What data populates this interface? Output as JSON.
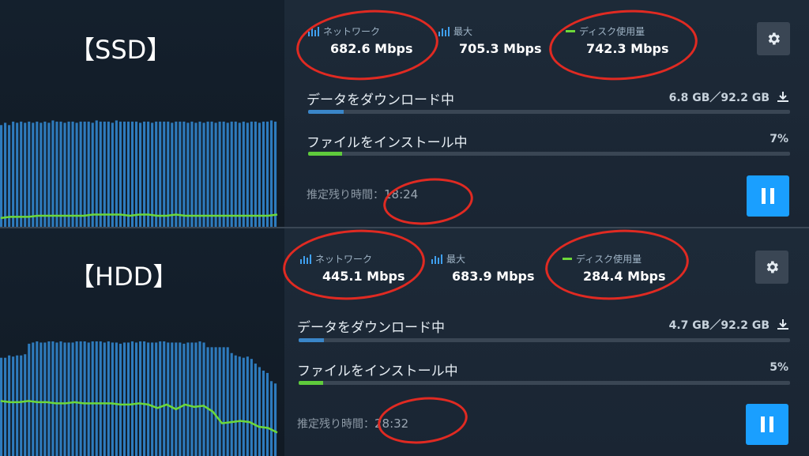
{
  "panels": [
    {
      "id": "ssd",
      "label": "【SSD】",
      "network_label": "ネットワーク",
      "network_value": "682.6 Mbps",
      "peak_label": "最大",
      "peak_value": "705.3 Mbps",
      "disk_label": "ディスク使用量",
      "disk_value": "742.3 Mbps",
      "download_label": "データをダウンロード中",
      "download_amount": "6.8 GB／92.2 GB",
      "download_progress": 0.074,
      "install_label": "ファイルをインストール中",
      "install_percent": "7%",
      "install_progress": 0.07,
      "time_label": "推定残り時間：",
      "time_value": "18:24",
      "bars": [
        0.93,
        0.95,
        0.93,
        0.96,
        0.95,
        0.96,
        0.95,
        0.96,
        0.95,
        0.96,
        0.95,
        0.96,
        0.95,
        0.97,
        0.96,
        0.96,
        0.95,
        0.96,
        0.96,
        0.95,
        0.96,
        0.96,
        0.96,
        0.95,
        0.97,
        0.96,
        0.96,
        0.96,
        0.95,
        0.97,
        0.96,
        0.96,
        0.96,
        0.96,
        0.96,
        0.95,
        0.96,
        0.96,
        0.95,
        0.96,
        0.96,
        0.96,
        0.96,
        0.95,
        0.96,
        0.96,
        0.96,
        0.95,
        0.96,
        0.95,
        0.96,
        0.95,
        0.96,
        0.96,
        0.95,
        0.96,
        0.96,
        0.95,
        0.96,
        0.96,
        0.95,
        0.96,
        0.95,
        0.96,
        0.96,
        0.95,
        0.96,
        0.96,
        0.97,
        0.96
      ],
      "disk_line": [
        0.13,
        0.14,
        0.14,
        0.14,
        0.15,
        0.15,
        0.15,
        0.15,
        0.15,
        0.15,
        0.16,
        0.16,
        0.16,
        0.16,
        0.15,
        0.16,
        0.16,
        0.15,
        0.15,
        0.16,
        0.15,
        0.15,
        0.15,
        0.15,
        0.15,
        0.15,
        0.15,
        0.15,
        0.15,
        0.15,
        0.16
      ]
    },
    {
      "id": "hdd",
      "label": "【HDD】",
      "network_label": "ネットワーク",
      "network_value": "445.1 Mbps",
      "peak_label": "最大",
      "peak_value": "683.9 Mbps",
      "disk_label": "ディスク使用量",
      "disk_value": "284.4 Mbps",
      "download_label": "データをダウンロード中",
      "download_amount": "4.7 GB／92.2 GB",
      "download_progress": 0.051,
      "install_label": "ファイルをインストール中",
      "install_percent": "5%",
      "install_progress": 0.05,
      "time_label": "推定残り時間：",
      "time_value": "28:32",
      "bars": [
        0.84,
        0.84,
        0.86,
        0.85,
        0.86,
        0.86,
        0.87,
        0.96,
        0.97,
        0.98,
        0.97,
        0.97,
        0.98,
        0.98,
        0.97,
        0.98,
        0.97,
        0.97,
        0.97,
        0.98,
        0.98,
        0.98,
        0.97,
        0.98,
        0.98,
        0.98,
        0.97,
        0.98,
        0.97,
        0.97,
        0.96,
        0.97,
        0.97,
        0.98,
        0.97,
        0.98,
        0.98,
        0.97,
        0.97,
        0.97,
        0.98,
        0.98,
        0.97,
        0.97,
        0.97,
        0.97,
        0.96,
        0.97,
        0.97,
        0.97,
        0.98,
        0.97,
        0.93,
        0.93,
        0.93,
        0.93,
        0.93,
        0.93,
        0.88,
        0.86,
        0.85,
        0.84,
        0.85,
        0.83,
        0.79,
        0.76,
        0.73,
        0.71,
        0.64,
        0.62
      ],
      "disk_line": [
        0.47,
        0.46,
        0.46,
        0.47,
        0.46,
        0.46,
        0.45,
        0.45,
        0.46,
        0.45,
        0.45,
        0.45,
        0.45,
        0.44,
        0.44,
        0.45,
        0.44,
        0.41,
        0.44,
        0.4,
        0.44,
        0.42,
        0.43,
        0.38,
        0.28,
        0.29,
        0.3,
        0.29,
        0.25,
        0.24,
        0.2
      ]
    }
  ],
  "colors": {
    "accent": "#1a9fff",
    "bar": "#2e7bbd",
    "bar_edge": "#4a9be0",
    "disk": "#6dd83a",
    "download_fill": "#3a86c8",
    "install_fill": "#5fcb3c",
    "annotation": "#e02a22"
  },
  "icons": {
    "network": "bar-chart-icon",
    "peak": "bar-chart-icon",
    "disk": "line-icon",
    "settings": "gear-icon",
    "download": "download-icon",
    "pause": "pause-icon"
  }
}
